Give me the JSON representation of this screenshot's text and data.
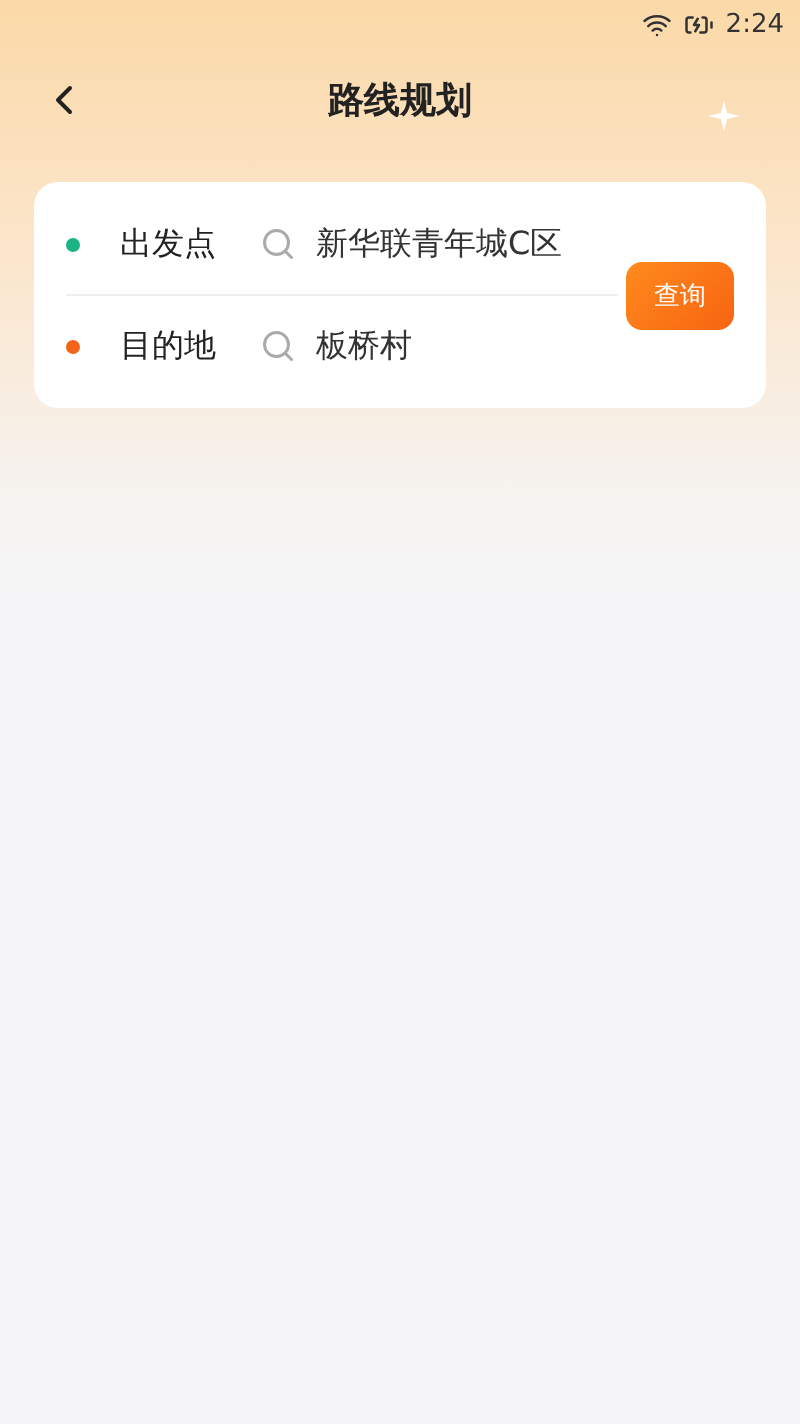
{
  "status_bar": {
    "time": "2:24"
  },
  "header": {
    "title": "路线规划"
  },
  "route": {
    "points": [
      {
        "label": "出发点",
        "value": "新华联青年城C区",
        "color": "#1cb482"
      },
      {
        "label": "目的地",
        "value": "板桥村",
        "color": "#f2641a"
      }
    ],
    "button": "查询"
  }
}
